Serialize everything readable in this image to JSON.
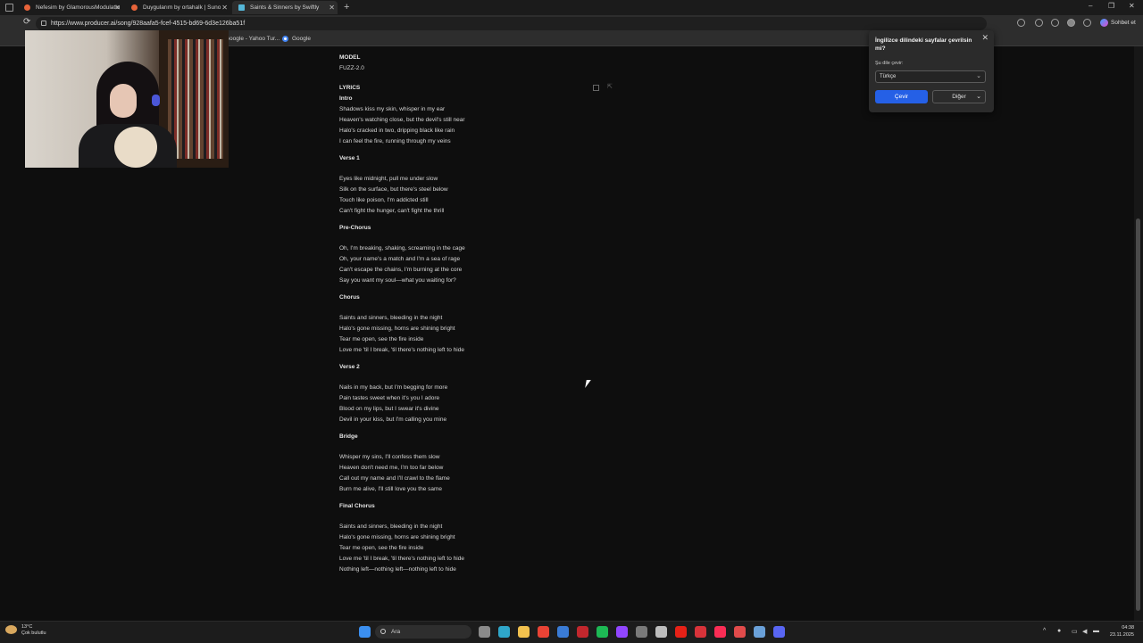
{
  "browser": {
    "tabs": [
      {
        "title": "Nefesim by GlamorousModulatio",
        "favicon_color": "#e8643a",
        "active": false
      },
      {
        "title": "Duygularım by ortahalk | Suno",
        "favicon_color": "#e8643a",
        "active": false
      },
      {
        "title": "Saints & Sinners by Swiftly",
        "favicon_color": "#55b7d8",
        "active": true
      }
    ],
    "new_tab_label": "+",
    "window_controls": {
      "minimize": "–",
      "maximize": "❐",
      "close": "✕"
    },
    "url": "https://www.producer.ai/song/928aafa5-fcef-4515-bd69-6d3e126ba51f",
    "chat_label": "Sohbet et",
    "bookmarks": [
      {
        "label": "Google - Yahoo Tur..."
      },
      {
        "label": "Google"
      }
    ]
  },
  "page": {
    "model_label": "MODEL",
    "model_value": "FUZZ-2.0",
    "lyrics_label": "LYRICS",
    "sections": [
      {
        "heading": "Intro",
        "lines": [
          "Shadows kiss my skin, whisper in my ear",
          "Heaven's watching close, but the devil's still near",
          "Halo's cracked in two, dripping black like rain",
          "I can feel the fire, running through my veins"
        ]
      },
      {
        "heading": "Verse 1",
        "lines": [
          "Eyes like midnight, pull me under slow",
          "Silk on the surface, but there's steel below",
          "Touch like poison, I'm addicted still",
          "Can't fight the hunger, can't fight the thrill"
        ]
      },
      {
        "heading": "Pre-Chorus",
        "lines": [
          "Oh, I'm breaking, shaking, screaming in the cage",
          "Oh, your name's a match and I'm a sea of rage",
          "Can't escape the chains, I'm burning at the core",
          "Say you want my soul—what you waiting for?"
        ]
      },
      {
        "heading": "Chorus",
        "lines": [
          "Saints and sinners, bleeding in the night",
          "Halo's gone missing, horns are shining bright",
          "Tear me open, see the fire inside",
          "Love me 'til I break, 'til there's nothing left to hide"
        ]
      },
      {
        "heading": "Verse 2",
        "lines": [
          "Nails in my back, but I'm begging for more",
          "Pain tastes sweet when it's you I adore",
          "Blood on my lips, but I swear it's divine",
          "Devil in your kiss, but I'm calling you mine"
        ]
      },
      {
        "heading": "Bridge",
        "lines": [
          "Whisper my sins, I'll confess them slow",
          "Heaven don't need me, I'm too far below",
          "Call out my name and I'll crawl to the flame",
          "Burn me alive, I'll still love you the same"
        ]
      },
      {
        "heading": "Final Chorus",
        "lines": [
          "Saints and sinners, bleeding in the night",
          "Halo's gone missing, horns are shining bright",
          "Tear me open, see the fire inside",
          "Love me 'til I break, 'til there's nothing left to hide",
          "Nothing left—nothing left—nothing left to hide"
        ]
      }
    ]
  },
  "translate_popup": {
    "title": "İngilizce dilindeki sayfalar çevrilsin mi?",
    "target_label": "Şu dile çevir:",
    "selected_language": "Türkçe",
    "translate_button": "Çevir",
    "more_button": "Diğer",
    "close_label": "✕"
  },
  "taskbar": {
    "weather_temp": "13°C",
    "weather_desc": "Çok bulutlu",
    "search_placeholder": "Ara",
    "time": "04:38",
    "date": "23.11.2025",
    "pinned_apps": [
      {
        "name": "start-icon",
        "color": "#3b8ff0"
      },
      {
        "name": "task-view-icon",
        "color": "#8a8a8a"
      },
      {
        "name": "edge-icon",
        "color": "#2fa6c9"
      },
      {
        "name": "file-explorer-icon",
        "color": "#f2c14e"
      },
      {
        "name": "chrome-icon",
        "color": "#e94335"
      },
      {
        "name": "store-icon",
        "color": "#3a7bd5"
      },
      {
        "name": "app-red-icon",
        "color": "#c2272d"
      },
      {
        "name": "spotify-icon",
        "color": "#1db954"
      },
      {
        "name": "twitch-icon",
        "color": "#9146ff"
      },
      {
        "name": "settings-icon",
        "color": "#7a7a7a"
      },
      {
        "name": "mail-icon",
        "color": "#bdbdbd"
      },
      {
        "name": "youtube-icon",
        "color": "#e62117"
      },
      {
        "name": "capcut-icon",
        "color": "#d8333a"
      },
      {
        "name": "music-icon",
        "color": "#fa2d55"
      },
      {
        "name": "app-circle-icon",
        "color": "#e14b4b"
      },
      {
        "name": "steam-icon",
        "color": "#6aa0d8"
      },
      {
        "name": "discord-icon",
        "color": "#5865f2"
      }
    ]
  }
}
